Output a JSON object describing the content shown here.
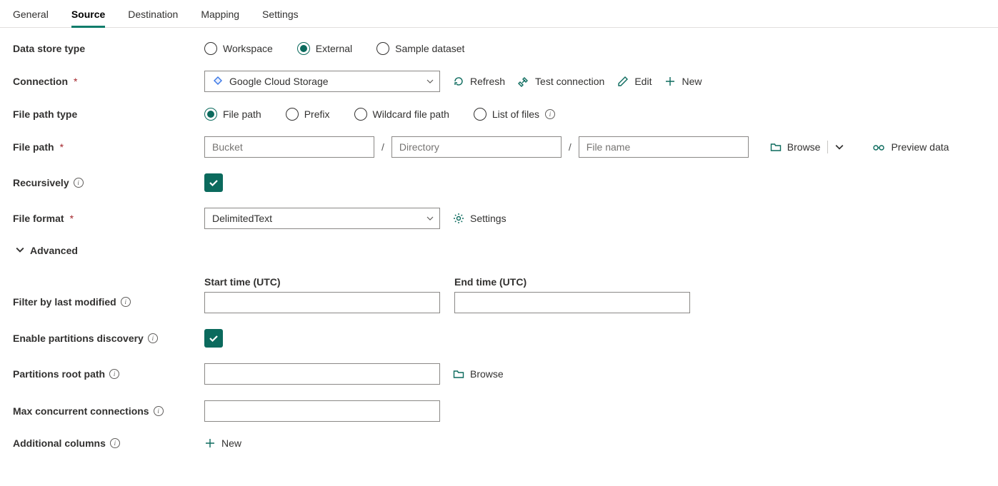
{
  "tabs": {
    "general": "General",
    "source": "Source",
    "destination": "Destination",
    "mapping": "Mapping",
    "settings": "Settings",
    "active": "source"
  },
  "labels": {
    "data_store_type": "Data store type",
    "connection": "Connection",
    "file_path_type": "File path type",
    "file_path": "File path",
    "recursively": "Recursively",
    "file_format": "File format",
    "advanced": "Advanced",
    "start_time": "Start time (UTC)",
    "end_time": "End time (UTC)",
    "filter_by_last_modified": "Filter by last modified",
    "enable_partitions_discovery": "Enable partitions discovery",
    "partitions_root_path": "Partitions root path",
    "max_concurrent_connections": "Max concurrent connections",
    "additional_columns": "Additional columns"
  },
  "data_store_type": {
    "options": {
      "workspace": "Workspace",
      "external": "External",
      "sample": "Sample dataset"
    },
    "selected": "external"
  },
  "connection": {
    "value": "Google Cloud Storage",
    "actions": {
      "refresh": "Refresh",
      "test": "Test connection",
      "edit": "Edit",
      "new": "New"
    }
  },
  "file_path_type": {
    "options": {
      "file_path": "File path",
      "prefix": "Prefix",
      "wildcard": "Wildcard file path",
      "list": "List of files"
    },
    "selected": "file_path"
  },
  "file_path": {
    "bucket_placeholder": "Bucket",
    "directory_placeholder": "Directory",
    "file_placeholder": "File name",
    "browse": "Browse",
    "preview": "Preview data"
  },
  "recursively_checked": true,
  "file_format": {
    "value": "DelimitedText",
    "settings": "Settings"
  },
  "partitions": {
    "checked": true,
    "browse": "Browse"
  },
  "additional_columns": {
    "new": "New"
  }
}
